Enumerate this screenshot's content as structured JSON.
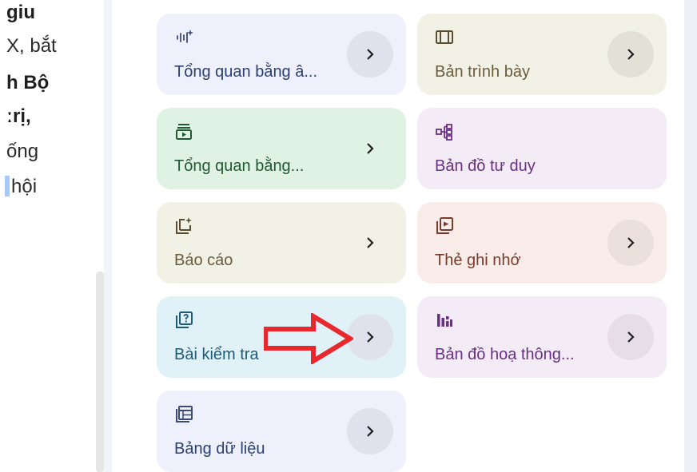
{
  "left_text": {
    "lines": [
      "giu",
      "X, bắt",
      "h Bộ",
      "ːrị,",
      "ống",
      "hội"
    ]
  },
  "cards": [
    {
      "label": "Tổng quan bằng â...",
      "icon": "audio-waveform-sparkle-icon"
    },
    {
      "label": "Bản trình bày",
      "icon": "slideshow-icon"
    },
    {
      "label": "Tổng quan bằng...",
      "icon": "video-overview-icon"
    },
    {
      "label": "Bản đồ tư duy",
      "icon": "mind-map-icon"
    },
    {
      "label": "Báo cáo",
      "icon": "report-sparkle-icon"
    },
    {
      "label": "Thẻ ghi nhớ",
      "icon": "flashcards-icon"
    },
    {
      "label": "Bài kiểm tra",
      "icon": "quiz-icon"
    },
    {
      "label": "Bản đồ hoạ thông...",
      "icon": "infographic-icon"
    },
    {
      "label": "Bảng dữ liệu",
      "icon": "data-table-icon"
    }
  ],
  "colors": {
    "arrow_annotation": "#e8282c",
    "blue_card": "#eef0fb",
    "beige_card": "#f2f1e6",
    "green_card": "#dff2e3",
    "purple_card": "#f3ecf6",
    "pink_card": "#f9ece9",
    "cyan_card": "#e0f1f7"
  }
}
